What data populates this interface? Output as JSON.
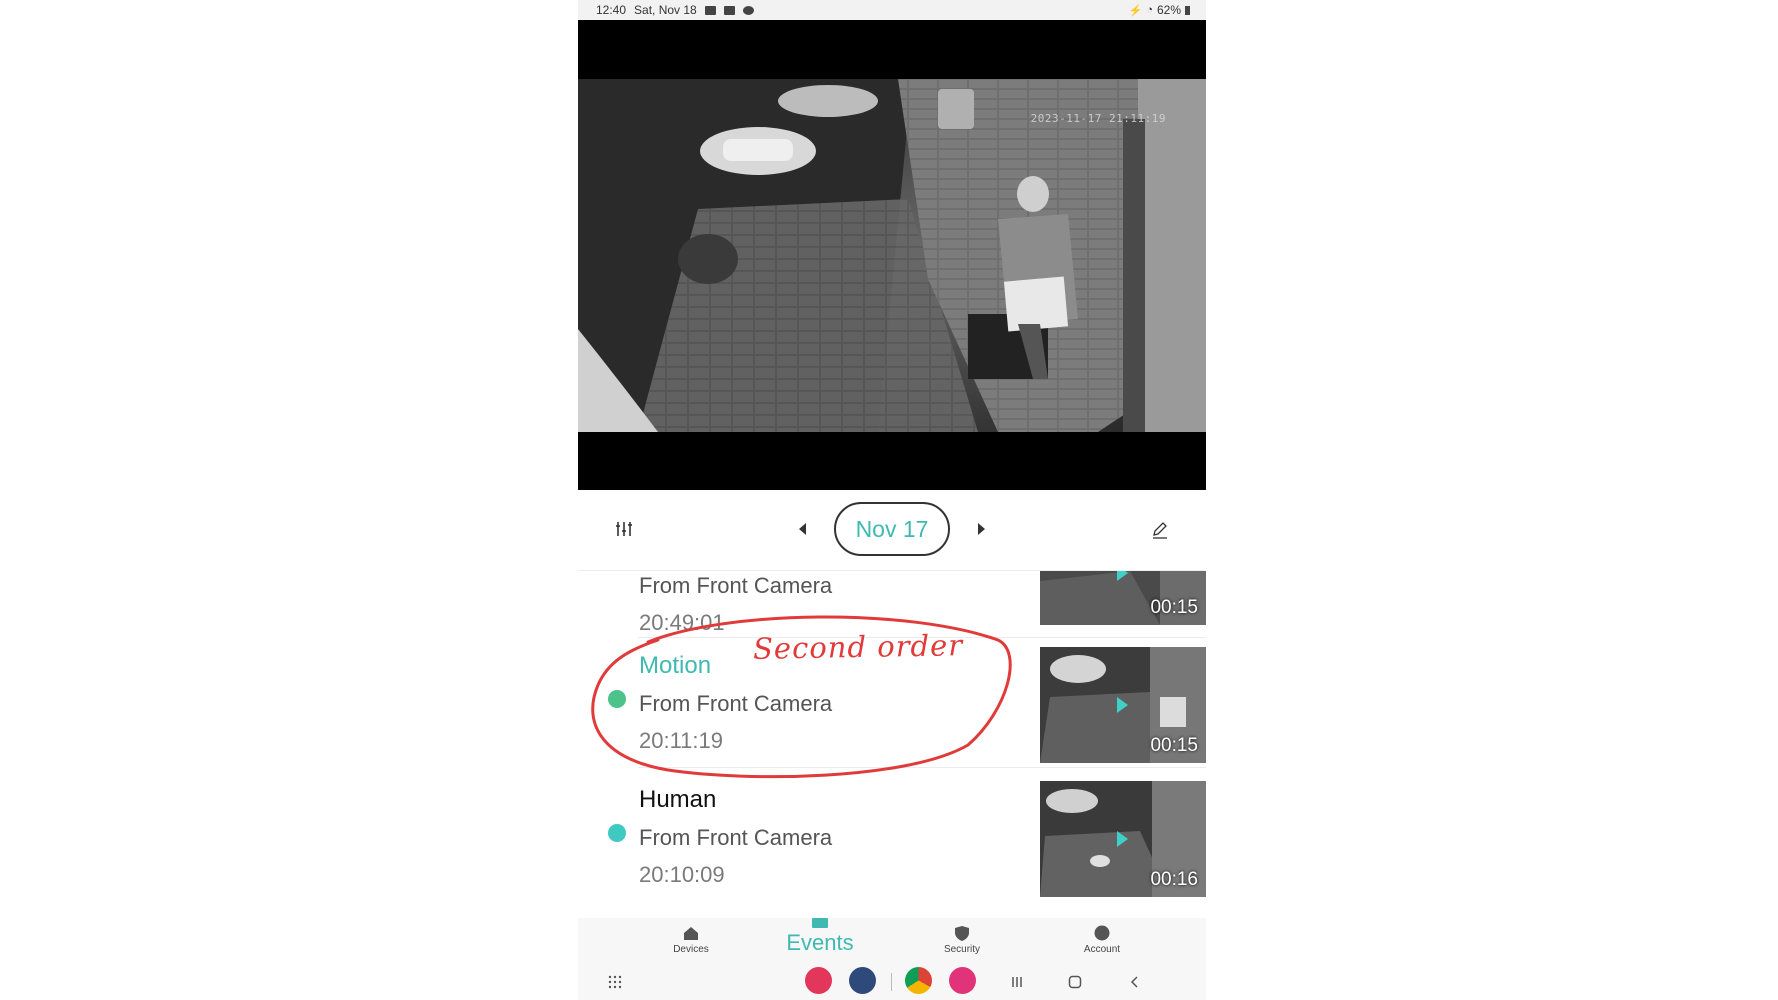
{
  "status_bar": {
    "time": "12:40",
    "date": "Sat, Nov 18",
    "battery": "62%"
  },
  "video": {
    "timestamp": "2023-11-17 21:11:19"
  },
  "date_nav": {
    "date": "Nov 17"
  },
  "events": [
    {
      "type": "",
      "source": "From Front Camera",
      "time": "20:49:01",
      "duration": "00:15"
    },
    {
      "type": "Motion",
      "source": "From Front Camera",
      "time": "20:11:19",
      "duration": "00:15",
      "type_color": "#3fb9b1",
      "dot_color": "#4cc38a"
    },
    {
      "type": "Human",
      "source": "From Front Camera",
      "time": "20:10:09",
      "duration": "00:16",
      "type_color": "#111111",
      "dot_color": "#3fc9c0"
    }
  ],
  "annotation": {
    "text": "Second order",
    "color": "#e03a3a"
  },
  "bottom_nav": {
    "devices": "Devices",
    "events": "Events",
    "security": "Security",
    "account": "Account"
  },
  "colors": {
    "accent": "#3fb9b1"
  }
}
